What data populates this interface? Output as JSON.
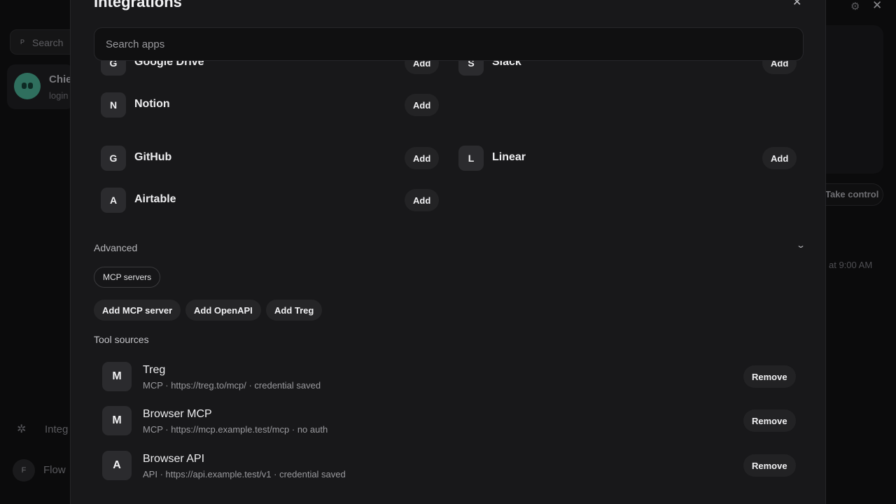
{
  "background": {
    "search_prefix": "P",
    "search_placeholder": "Search",
    "card_name": "Chie",
    "card_sub": "login",
    "nav_integrations": "Integ",
    "nav_flow_initial": "F",
    "nav_flow": "Flow",
    "take_control": "Take control",
    "time_text": "at 9:00 AM"
  },
  "modal": {
    "title": "Integrations",
    "search_placeholder": "Search apps",
    "apps": [
      {
        "initial": "G",
        "name": "Google Drive",
        "action": "Add"
      },
      {
        "initial": "S",
        "name": "Slack",
        "action": "Add"
      },
      {
        "initial": "N",
        "name": "Notion",
        "action": "Add"
      },
      {
        "initial": "G",
        "name": "GitHub",
        "action": "Add"
      },
      {
        "initial": "L",
        "name": "Linear",
        "action": "Add"
      },
      {
        "initial": "A",
        "name": "Airtable",
        "action": "Add"
      }
    ],
    "advanced": {
      "label": "Advanced",
      "chip": "MCP servers",
      "buttons": [
        "Add MCP server",
        "Add OpenAPI",
        "Add Treg"
      ]
    },
    "tool_sources": {
      "label": "Tool sources",
      "items": [
        {
          "initial": "M",
          "name": "Treg",
          "meta": "MCP · https://treg.to/mcp/ · credential saved",
          "action": "Remove"
        },
        {
          "initial": "M",
          "name": "Browser MCP",
          "meta": "MCP · https://mcp.example.test/mcp · no auth",
          "action": "Remove"
        },
        {
          "initial": "A",
          "name": "Browser API",
          "meta": "API · https://api.example.test/v1 · credential saved",
          "action": "Remove"
        }
      ]
    }
  },
  "icons": {
    "close": "close-icon",
    "chevron": "chevron-down-icon",
    "gear": "gear-icon",
    "plug": "plug-icon"
  }
}
